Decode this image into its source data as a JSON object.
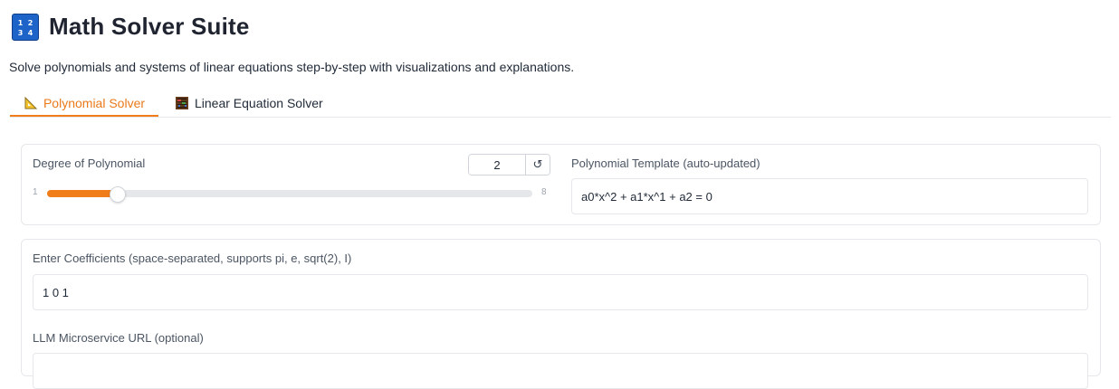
{
  "app": {
    "icon": "input-numbers-icon",
    "logo_digits": [
      "1",
      "2",
      "3",
      "4"
    ],
    "title": "Math Solver Suite",
    "subtitle": "Solve polynomials and systems of linear equations step-by-step with visualizations and explanations."
  },
  "tabs": [
    {
      "label": "Polynomial Solver",
      "icon": "triangular-ruler-icon",
      "active": true
    },
    {
      "label": "Linear Equation Solver",
      "icon": "abacus-icon",
      "active": false
    }
  ],
  "degree": {
    "label": "Degree of Polynomial",
    "value": "2",
    "min": "1",
    "max": "8",
    "reset_icon": "↺"
  },
  "template": {
    "label": "Polynomial Template (auto-updated)",
    "value": "a0*x^2 + a1*x^1 + a2 = 0"
  },
  "coefficients": {
    "label": "Enter Coefficients (space-separated, supports pi, e, sqrt(2), I)",
    "value": "1 0 1"
  },
  "llm_url": {
    "label": "LLM Microservice URL (optional)",
    "value": ""
  },
  "colors": {
    "accent": "#f07c1a",
    "logo_bg": "#1e63c8"
  }
}
